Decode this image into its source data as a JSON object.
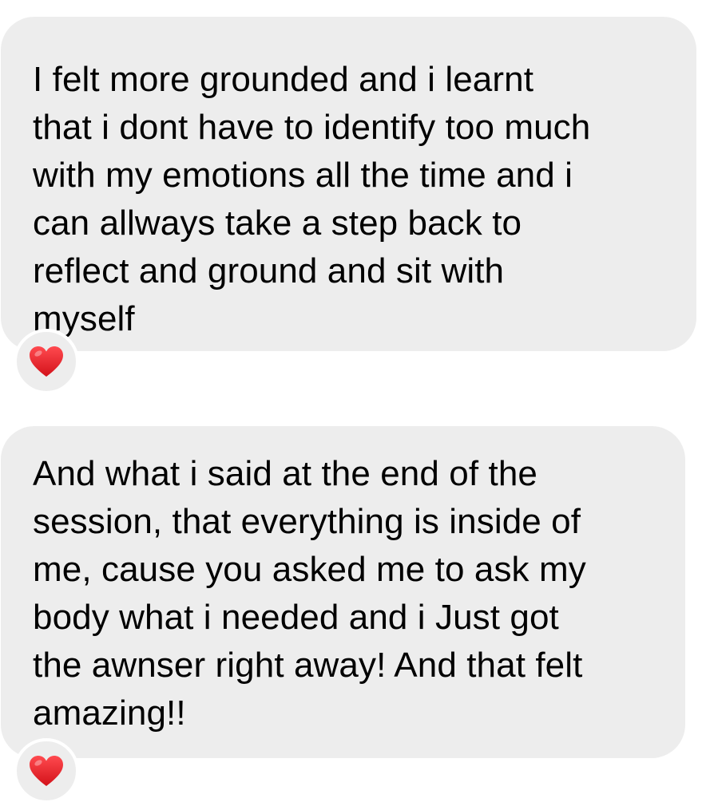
{
  "messages": [
    {
      "text": "I felt more grounded and i learnt\nthat i dont have to identify too much\nwith my emotions all the time and i\ncan allways take a step back to\nreflect and ground and sit with\nmyself",
      "reaction": "red-heart-icon"
    },
    {
      "text": "And what i said at the end of the\nsession, that everything is inside of\nme, cause you asked me to ask my\nbody what i needed and i Just got\nthe awnser right away! And that felt\namazing!!",
      "reaction": "red-heart-icon"
    }
  ],
  "colors": {
    "bubble": "#ededed",
    "text": "#000000",
    "heart": "#e5232a",
    "background": "#ffffff"
  }
}
